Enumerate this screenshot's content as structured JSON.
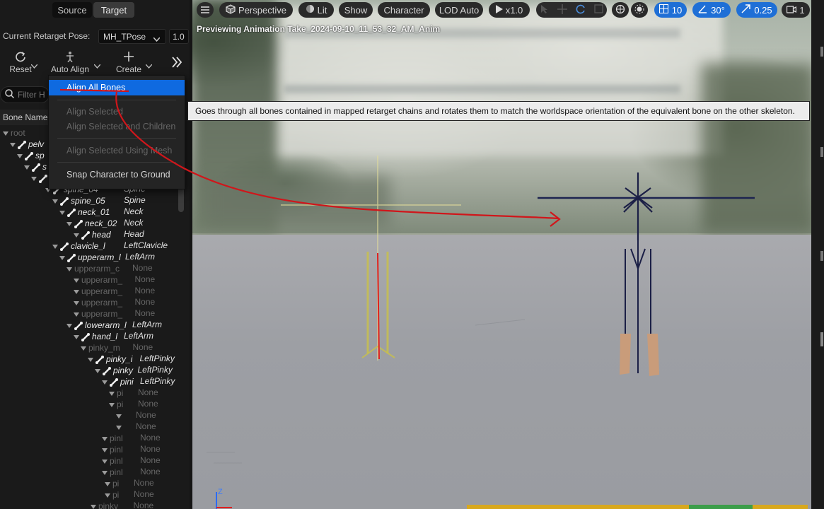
{
  "left_panel": {
    "tabs": [
      {
        "label": "Source"
      },
      {
        "label": "Target"
      }
    ],
    "retarget_pose_label": "Current Retarget Pose:",
    "retarget_pose_value": "MH_TPose",
    "retarget_pose_scale": "1.0",
    "toolbar": {
      "reset": "Reset",
      "auto_align": "Auto Align",
      "create": "Create"
    },
    "filter_placeholder": "Filter H",
    "column_bone_name": "Bone Name",
    "tree": [
      {
        "name": "root",
        "chain": "",
        "dim": true
      },
      {
        "name": "pelv",
        "chain": ""
      },
      {
        "name": "sp",
        "chain": ""
      },
      {
        "name": "s",
        "chain": ""
      },
      {
        "name": "",
        "chain": ""
      },
      {
        "name": "spine_04",
        "chain": "Spine"
      },
      {
        "name": "spine_05",
        "chain": "Spine"
      },
      {
        "name": "neck_01",
        "chain": "Neck"
      },
      {
        "name": "neck_02",
        "chain": "Neck"
      },
      {
        "name": "head",
        "chain": "Head"
      },
      {
        "name": "clavicle_l",
        "chain": "LeftClavicle"
      },
      {
        "name": "upperarm_l",
        "chain": "LeftArm"
      },
      {
        "name": "upperarm_c",
        "chain": "None",
        "dim": true
      },
      {
        "name": "upperarm_",
        "chain": "None",
        "dim": true
      },
      {
        "name": "upperarm_",
        "chain": "None",
        "dim": true
      },
      {
        "name": "upperarm_",
        "chain": "None",
        "dim": true
      },
      {
        "name": "upperarm_",
        "chain": "None",
        "dim": true
      },
      {
        "name": "lowerarm_l",
        "chain": "LeftArm"
      },
      {
        "name": "hand_l",
        "chain": "LeftArm"
      },
      {
        "name": "pinky_m",
        "chain": "None",
        "dim": true
      },
      {
        "name": "pinky_i",
        "chain": "LeftPinky"
      },
      {
        "name": "pinky",
        "chain": "LeftPinky"
      },
      {
        "name": "pini",
        "chain": "LeftPinky"
      },
      {
        "name": "pi",
        "chain": "None",
        "dim": true
      },
      {
        "name": "pi",
        "chain": "None",
        "dim": true
      },
      {
        "name": "",
        "chain": "None",
        "dim": true
      },
      {
        "name": "",
        "chain": "None",
        "dim": true
      },
      {
        "name": "pinl",
        "chain": "None",
        "dim": true
      },
      {
        "name": "pinl",
        "chain": "None",
        "dim": true
      },
      {
        "name": "pinl",
        "chain": "None",
        "dim": true
      },
      {
        "name": "pinl",
        "chain": "None",
        "dim": true
      },
      {
        "name": "pi",
        "chain": "None",
        "dim": true
      },
      {
        "name": "pi",
        "chain": "None",
        "dim": true
      },
      {
        "name": "pinky",
        "chain": "None",
        "dim": true
      }
    ]
  },
  "context_menu": {
    "items": [
      {
        "label": "Align All Bones"
      },
      {
        "label": "Align Selected"
      },
      {
        "label": "Align Selected and Children"
      },
      {
        "label": "Align Selected Using Mesh"
      },
      {
        "label": "Snap Character to Ground"
      }
    ]
  },
  "tooltip": "Goes through all bones contained in mapped retarget chains and rotates them to match the worldspace orientation of the equivalent bone on the other skeleton.",
  "viewport": {
    "toolbar": {
      "perspective": "Perspective",
      "lit": "Lit",
      "show": "Show",
      "character": "Character",
      "lod": "LOD Auto",
      "play_speed": "x1.0",
      "grid_value": "10",
      "angle_value": "30°",
      "scale_value": "0.25",
      "camera_speed": "1"
    },
    "preview_text": "Previewing Animation Take_2024-09-10_11_53_32_AM_Anim",
    "axis_label": "Z"
  },
  "colors": {
    "accent": "#1f6fd6",
    "selection": "#0f6ae0",
    "annotation": "#d0161b"
  }
}
